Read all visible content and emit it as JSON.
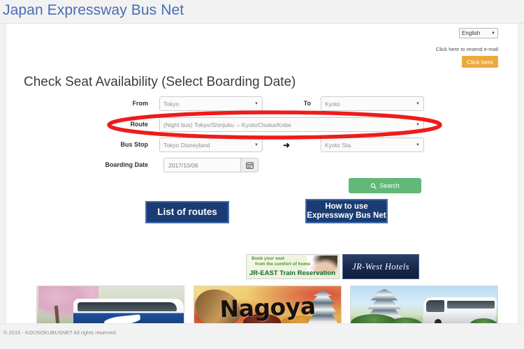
{
  "header": {
    "site_title": "Japan Expressway Bus Net"
  },
  "utility": {
    "language_value": "English",
    "language_caret": "▼",
    "resend_text": "Click here to resend e-mail",
    "resend_button_label": "Click here"
  },
  "main": {
    "heading": "Check Seat Availability (Select Boarding Date)"
  },
  "form": {
    "caret": "▼",
    "from": {
      "label": "From",
      "value": "Tokyo"
    },
    "to": {
      "label": "To",
      "value": "Kyoto"
    },
    "route": {
      "label": "Route",
      "value": "(Night bus) Tokyo/Shinjuku ⇔Kyoto/Osaka/Kobe"
    },
    "bus_stop": {
      "label": "Bus Stop",
      "origin_value": "Tokyo Disneyland",
      "destination_value": "Kyoto Sta.",
      "separator": "➜"
    },
    "boarding_date": {
      "label": "Boarding Date",
      "value": "2017/10/06",
      "picker_icon": "calendar-icon"
    },
    "search_button": {
      "label": "Search",
      "icon": "search-icon"
    }
  },
  "nav_buttons": {
    "list_of_routes": "List of routes",
    "how_to_use_line1": "How to use",
    "how_to_use_line2": "Expressway Bus Net"
  },
  "banners": {
    "jr_east": {
      "tagline_line1": "Book your seat",
      "tagline_line2": "from the comfort of home",
      "title": "JR-EAST Train Reservation"
    },
    "jr_west": {
      "title": "JR-West Hotels"
    }
  },
  "photos": {
    "bus_sakura_alt": "Blue and white expressway bus parked under cherry blossom trees",
    "nagoya_alt": "Nagoya",
    "castle_bus_alt": "Japanese castle with a white expressway bus"
  },
  "annotation": {
    "target": "route-row",
    "shape": "ellipse",
    "color": "#ef1b1b"
  },
  "footer": {
    "copyright": "© 2015 - KOUSOKUBUSNET All rights reserved."
  },
  "colors": {
    "site_title": "#4a6db5",
    "accent_orange": "#eda940",
    "accent_green": "#61b877",
    "navy": "#1b3c72",
    "annotation_red": "#ef1b1b"
  }
}
